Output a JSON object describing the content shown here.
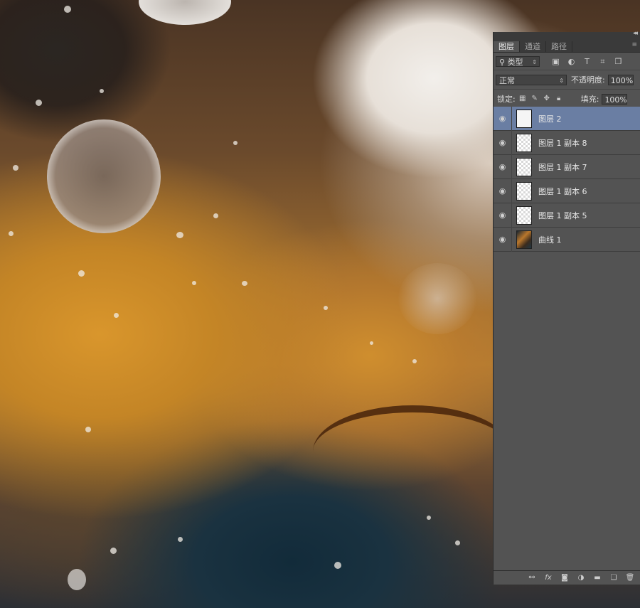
{
  "panel": {
    "tabs": [
      {
        "label": "图层"
      },
      {
        "label": "通道"
      },
      {
        "label": "路径"
      }
    ],
    "filter": {
      "kind_label": "类型"
    },
    "blend_mode": "正常",
    "opacity": {
      "label": "不透明度:",
      "value": "100%"
    },
    "lock": {
      "label": "锁定:"
    },
    "fill": {
      "label": "填充:",
      "value": "100%"
    },
    "layers": [
      {
        "name": "图层 2",
        "selected": true,
        "thumb": "white"
      },
      {
        "name": "图层 1 副本 8",
        "selected": false,
        "thumb": "transparent"
      },
      {
        "name": "图层 1 副本 7",
        "selected": false,
        "thumb": "transparent"
      },
      {
        "name": "图层 1 副本 6",
        "selected": false,
        "thumb": "transparent"
      },
      {
        "name": "图层 1 副本 5",
        "selected": false,
        "thumb": "transparent"
      },
      {
        "name": "曲线 1",
        "selected": false,
        "thumb": "adjustment"
      }
    ],
    "bottom_icons": [
      "link-icon",
      "fx-icon",
      "mask-icon",
      "adjustment-icon",
      "group-folder-icon",
      "new-layer-icon",
      "trash-icon"
    ]
  },
  "colors": {
    "panel_bg": "#535353",
    "selected_layer": "#6a7ea3"
  }
}
